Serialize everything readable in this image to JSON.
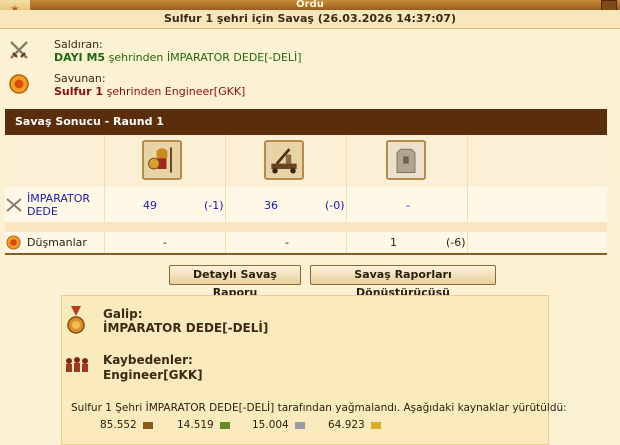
{
  "window": {
    "title": "Ordu",
    "subtitle": "Sulfur 1 şehri için Savaş (26.03.2026 14:37:07)"
  },
  "attacker": {
    "label": "Saldıran:",
    "player": "DAYI M5",
    "text": "şehrinden İMPARATOR DEDE[-DELİ]"
  },
  "defender": {
    "label": "Savunan:",
    "city": "Sulfur 1",
    "text": "şehrinden Engineer[GKK]"
  },
  "result": {
    "title": "Savaş Sonucu - Raund 1"
  },
  "units": [
    {
      "name": "hoplite-unit-icon"
    },
    {
      "name": "catapult-unit-icon"
    },
    {
      "name": "wall-unit-icon"
    }
  ],
  "rows": {
    "attacker": {
      "name": "İMPARATOR DEDE",
      "cells": [
        {
          "count": "49",
          "loss": "(-1)"
        },
        {
          "count": "36",
          "loss": "(-0)"
        },
        {
          "count": "-",
          "loss": ""
        }
      ]
    },
    "enemies": {
      "name": "Düşmanlar",
      "cells": [
        {
          "count": "-",
          "loss": ""
        },
        {
          "count": "-",
          "loss": ""
        },
        {
          "count": "1",
          "loss": "(-6)"
        }
      ]
    }
  },
  "buttons": {
    "detailed": "Detaylı Savaş Raporu",
    "converter": "Savaş Raporları Dönüştürücüsü"
  },
  "summary": {
    "winner_label": "Galip:",
    "winner": "İMPARATOR DEDE[-DELİ]",
    "loser_label": "Kaybedenler:",
    "loser": "Engineer[GKK]",
    "loot_text": "Sulfur 1 Şehri İMPARATOR DEDE[-DELİ] tarafından yağmalandı. Aşağıdaki kaynaklar yürütüldü:",
    "resources": [
      {
        "value": "85.552",
        "icon": "wood-icon",
        "color": "#8b5a1c"
      },
      {
        "value": "14.519",
        "icon": "wine-icon",
        "color": "#6a8a2a"
      },
      {
        "value": "15.004",
        "icon": "marble-icon",
        "color": "#9a9aa8"
      },
      {
        "value": "64.923",
        "icon": "crystal-icon",
        "color": "#d8b020"
      }
    ]
  }
}
